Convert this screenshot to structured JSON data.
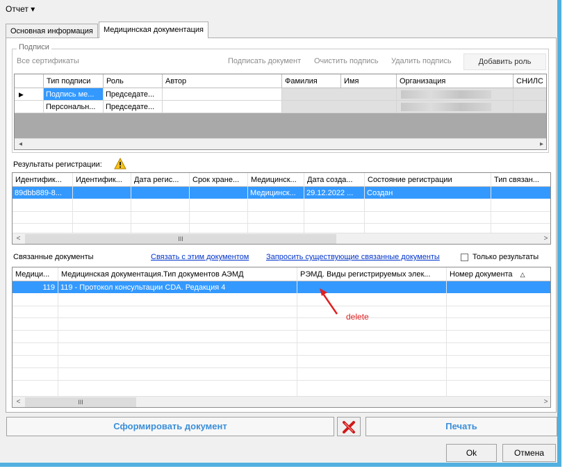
{
  "menu": {
    "report": "Отчет"
  },
  "tabs": [
    {
      "label": "Основная информация",
      "active": false
    },
    {
      "label": "Медицинская документация",
      "active": true
    }
  ],
  "signatures": {
    "legend": "Подписи",
    "all_certificates": "Все сертификаты",
    "sign_document": "Подписать документ",
    "clear_signature": "Очистить подпись",
    "delete_signature": "Удалить подпись",
    "add_role": "Добавить роль",
    "columns": [
      "Тип подписи",
      "Роль",
      "Автор",
      "Фамилия",
      "Имя",
      "Организация",
      "СНИЛС"
    ],
    "rows": [
      {
        "type": "Подпись ме...",
        "role": "Председате...",
        "selected": true
      },
      {
        "type": "Персональн...",
        "role": "Председате...",
        "selected": false
      }
    ]
  },
  "registration": {
    "label": "Результаты регистрации:",
    "warning_icon": "warning-icon",
    "columns": [
      "Идентифик...",
      "Идентифик...",
      "Дата регис...",
      "Срок хране...",
      "Медицинск...",
      "Дата созда...",
      "Состояние регистрации",
      "Тип связан..."
    ],
    "rows": [
      {
        "id": "89dbb889-8...",
        "medical": "Медицинск...",
        "created": "29.12.2022 ...",
        "state": "Создан"
      }
    ],
    "scroll_thumb": "III"
  },
  "linked": {
    "label": "Связанные документы",
    "link_this": "Связать с этим документом",
    "request_existing": "Запросить существующие связанные документы",
    "only_results": "Только результаты",
    "columns": [
      "Медици...",
      "Медицинская документация.Тип документов АЭМД",
      "РЭМД. Виды регистрируемых элек...",
      "Номер документа"
    ],
    "sort_icon": "triangle-up-icon",
    "rows": [
      {
        "num": "119",
        "type": "119 - Протокол консультации CDA. Редакция 4"
      }
    ],
    "scroll_thumb": "III"
  },
  "annotation": {
    "text": "delete",
    "color": "#e02020"
  },
  "footer": {
    "generate": "Сформировать документ",
    "print": "Печать",
    "ok": "Ok",
    "cancel": "Отмена"
  },
  "colors": {
    "selection": "#3399ff",
    "accent_border": "#52b0e0",
    "button_text": "#3a8fd9"
  }
}
